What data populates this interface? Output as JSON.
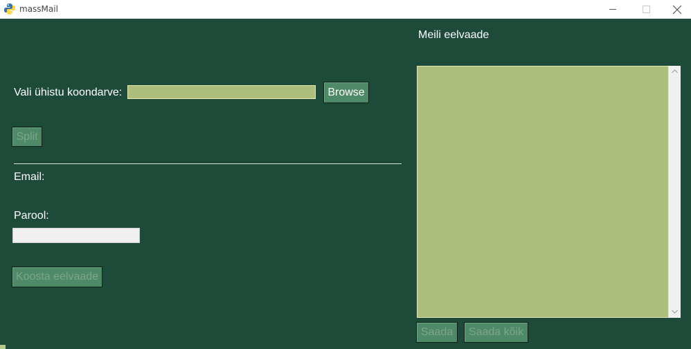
{
  "window": {
    "title": "massMail",
    "app_icon": "python-icon",
    "controls": [
      "minimize-icon",
      "maximize-icon",
      "close-icon"
    ]
  },
  "form": {
    "koondarve_label": "Vali ühistu koondarve:",
    "koondarve_value": "",
    "browse_label": "Browse",
    "split_label": "Split",
    "email_label": "Email:",
    "parool_label": "Parool:",
    "parool_value": "",
    "koosta_label": "Koosta eelvaade"
  },
  "preview": {
    "title": "Meili eelvaade",
    "content": "",
    "saada_label": "Saada",
    "saada_koik_label": "Saada kõik"
  },
  "colors": {
    "background": "#1d4a39",
    "field": "#adbd7b",
    "button": "#4f8a68",
    "button_disabled_text": "#7ba586"
  }
}
